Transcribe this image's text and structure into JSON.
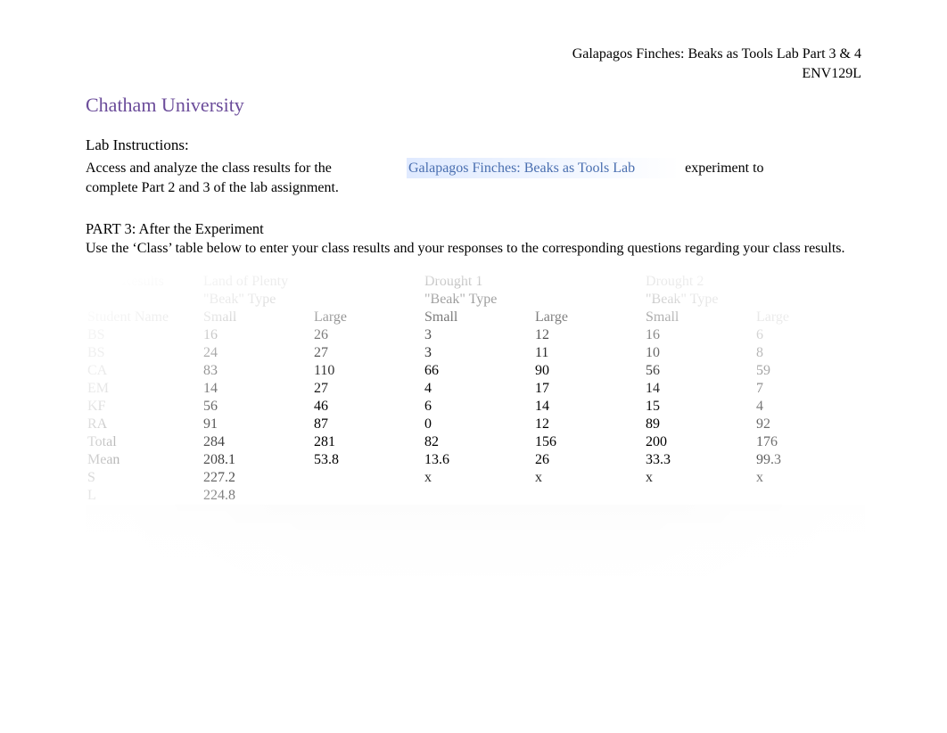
{
  "header": {
    "title": "Galapagos Finches: Beaks as Tools Lab Part 3 & 4",
    "course": "ENV129L"
  },
  "university": "Chatham University",
  "instructions": {
    "label": "Lab Instructions:",
    "left": "Access and analyze the class results for the",
    "link": "Galapagos Finches: Beaks as Tools Lab",
    "right": "experiment to",
    "cont": "complete Part 2 and 3 of the lab assignment."
  },
  "part3": {
    "heading": "PART 3: After the Experiment",
    "body": "Use the ‘Class’ table below to enter your class results and your responses to the corresponding questions regarding your class results."
  },
  "table": {
    "h_class_results": "Class Results",
    "h_lop": "Land of Plenty",
    "h_d1": "Drought 1",
    "h_d2": "Drought 2",
    "beak_type": "\"Beak\" Type",
    "h_student": "Student Name",
    "h_small": "Small",
    "h_large": "Large",
    "rows": [
      {
        "name": "BS",
        "v": [
          "16",
          "26",
          "3",
          "12",
          "16",
          "6"
        ]
      },
      {
        "name": "BS",
        "v": [
          "24",
          "27",
          "3",
          "11",
          "10",
          "8"
        ]
      },
      {
        "name": "CA",
        "v": [
          "83",
          "110",
          "66",
          "90",
          "56",
          "59"
        ]
      },
      {
        "name": "EM",
        "v": [
          "14",
          "27",
          "4",
          "17",
          "14",
          "7"
        ]
      },
      {
        "name": "KF",
        "v": [
          "56",
          "46",
          "6",
          "14",
          "15",
          "4"
        ]
      },
      {
        "name": "RA",
        "v": [
          "91",
          "87",
          "0",
          "12",
          "89",
          "92"
        ]
      }
    ],
    "total": {
      "label": "Total",
      "v": [
        "284",
        "281",
        "82",
        "156",
        "200",
        "176"
      ]
    },
    "mean": {
      "label": "Mean",
      "v": [
        "208.1",
        "53.8",
        "13.6",
        "26",
        "33.3",
        "99.3"
      ]
    },
    "s": {
      "label": "S",
      "v": [
        "227.2",
        "",
        "x",
        "x",
        "x",
        "x"
      ]
    },
    "l": {
      "label": "L",
      "v": [
        "224.8",
        "",
        "",
        "",
        "",
        ""
      ]
    }
  }
}
